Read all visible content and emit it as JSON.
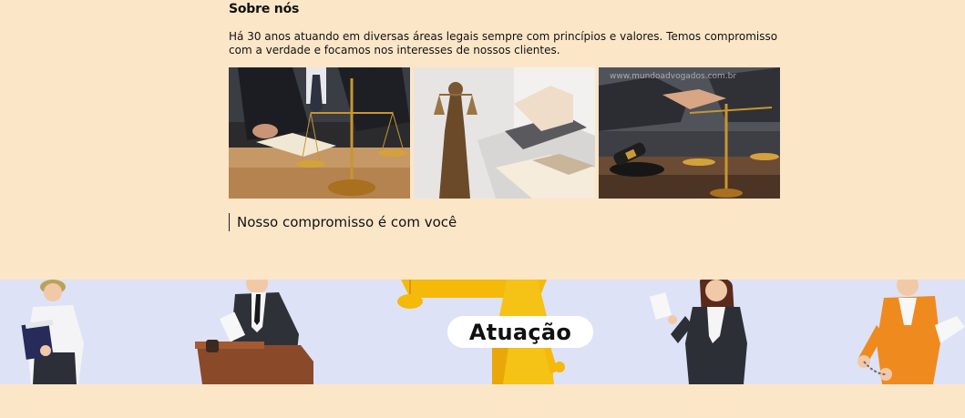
{
  "about": {
    "title": "Sobre nós",
    "description": "Há 30 anos atuando em diversas áreas legais sempre com princípios e valores. Temos compromisso com a verdade e focamos nos interesses de nossos clientes."
  },
  "gallery": [
    {
      "name": "photo-lawyer-scales"
    },
    {
      "name": "photo-justice-statue"
    },
    {
      "name": "photo-handshake-gavel",
      "watermark": "www.mundoadvogados.com.br"
    }
  ],
  "tagline": "Nosso compromisso é com você",
  "banner": {
    "title": "Atuação",
    "colors": {
      "background": "#dde2f6",
      "pill": "#ffffff",
      "accent": "#f5b90a"
    }
  }
}
